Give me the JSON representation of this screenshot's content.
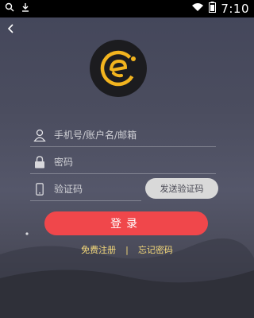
{
  "statusbar": {
    "time": "7:10"
  },
  "icons": {
    "search": "search-icon",
    "download": "download-icon",
    "wifi": "wifi-icon",
    "battery": "battery-icon",
    "back": "back-icon",
    "logo": "app-logo-icon",
    "user": "user-icon",
    "lock": "lock-icon",
    "phone": "phone-icon"
  },
  "form": {
    "account_placeholder": "手机号/账户名/邮箱",
    "password_placeholder": "密码",
    "code_placeholder": "验证码",
    "send_code_label": "发送验证码",
    "login_label": "登录"
  },
  "links": {
    "register": "免费注册",
    "separator": "|",
    "forgot": "忘记密码"
  },
  "colors": {
    "accent": "#f0474b",
    "link": "#f5d97a",
    "logo": "#f2b41f"
  }
}
